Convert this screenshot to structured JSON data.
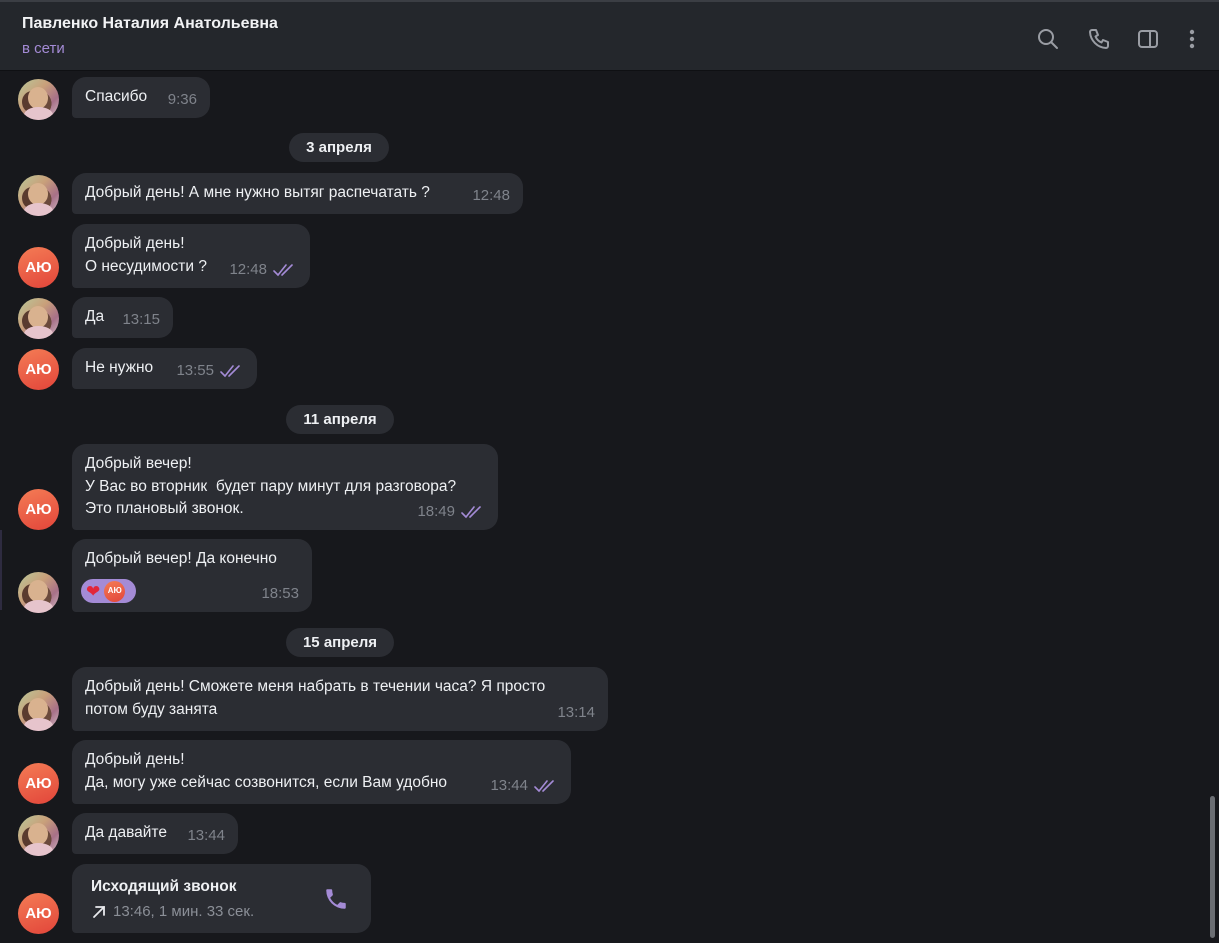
{
  "header": {
    "title": "Павленко Наталия Анатольевна",
    "status": "в сети",
    "icons": [
      "search-icon",
      "phone-icon",
      "sidebar-toggle-icon",
      "more-vertical-icon"
    ]
  },
  "colors": {
    "accent": "#a48bd6",
    "bubble": "#2b2d33",
    "background": "#17181c",
    "avatar_ayu": "#e8573f"
  },
  "me": {
    "initials": "АЮ"
  },
  "messages": [
    {
      "from": "contact",
      "text": "Спасибо",
      "time": "9:36"
    },
    {
      "type": "date",
      "text": "3 апреля"
    },
    {
      "from": "contact",
      "text": "Добрый день! А мне нужно вытяг распечатать ?",
      "time": "12:48"
    },
    {
      "from": "me",
      "text": "Добрый день!\nО несудимости ?",
      "time": "12:48",
      "read": true
    },
    {
      "from": "contact",
      "text": "Да",
      "time": "13:15"
    },
    {
      "from": "me",
      "text": "Не нужно",
      "time": "13:55",
      "read": true
    },
    {
      "type": "date",
      "text": "11 апреля"
    },
    {
      "from": "me",
      "text": "Добрый вечер!\nУ Вас во вторник  будет пару минут для разговора?\nЭто плановый звонок.",
      "time": "18:49",
      "read": true
    },
    {
      "from": "contact",
      "text": "Добрый вечер! Да конечно",
      "time": "18:53",
      "reaction": {
        "emoji": "❤",
        "by": "АЮ"
      }
    },
    {
      "type": "date",
      "text": "15 апреля"
    },
    {
      "from": "contact",
      "text": "Добрый день! Сможете меня набрать в течении часа? Я просто\nпотом буду занята",
      "time": "13:14"
    },
    {
      "from": "me",
      "text": "Добрый день!\nДа, могу уже сейчас созвонится, если Вам удобно",
      "time": "13:44",
      "read": true
    },
    {
      "from": "contact",
      "text": "Да давайте",
      "time": "13:44"
    },
    {
      "from": "me",
      "type": "call",
      "title": "Исходящий звонок",
      "details": "13:46, 1 мин. 33 сек."
    }
  ]
}
